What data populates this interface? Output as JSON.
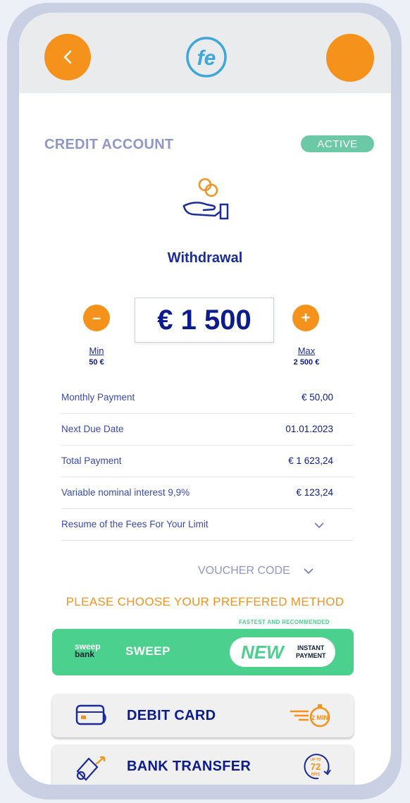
{
  "header": {
    "logo_text": "fe"
  },
  "account": {
    "title": "CREDIT ACCOUNT",
    "status": "ACTIVE"
  },
  "withdrawal": {
    "label": "Withdrawal",
    "amount": "€ 1 500",
    "minus_symbol": "–",
    "plus_symbol": "+",
    "min_label": "Min",
    "min_value": "50 €",
    "max_label": "Max",
    "max_value": "2 500 €"
  },
  "details": [
    {
      "label": "Monthly Payment",
      "value": "€  50,00"
    },
    {
      "label": "Next Due Date",
      "value": "01.01.2023"
    },
    {
      "label": "Total Payment",
      "value": "€ 1 623,24"
    },
    {
      "label": "Variable nominal interest 9,9%",
      "value": "€ 123,24"
    },
    {
      "label": "Resume of the Fees For Your Limit",
      "value": ""
    }
  ],
  "voucher": {
    "label": "VOUCHER CODE"
  },
  "methods": {
    "prompt": "PLEASE CHOOSE YOUR PREFFERED METHOD",
    "recommended_tag": "FASTEST AND RECOMMENDED",
    "sweep": {
      "logo_top": "sweep",
      "logo_bottom": "bank",
      "label": "SWEEP",
      "badge_new": "NEW",
      "badge_line1": "INSTANT",
      "badge_line2": "PAYMENT"
    },
    "debit": {
      "label": "DEBIT CARD",
      "time_badge": "2 MIN"
    },
    "bank_transfer": {
      "label": "BANK TRANSFER",
      "time_top": "UP TO",
      "time_value": "72",
      "time_unit": "HRS"
    }
  },
  "colors": {
    "accent": "#f5921c",
    "primary": "#0c1c8c",
    "success": "#4cd08e",
    "muted": "#8f97c7"
  }
}
